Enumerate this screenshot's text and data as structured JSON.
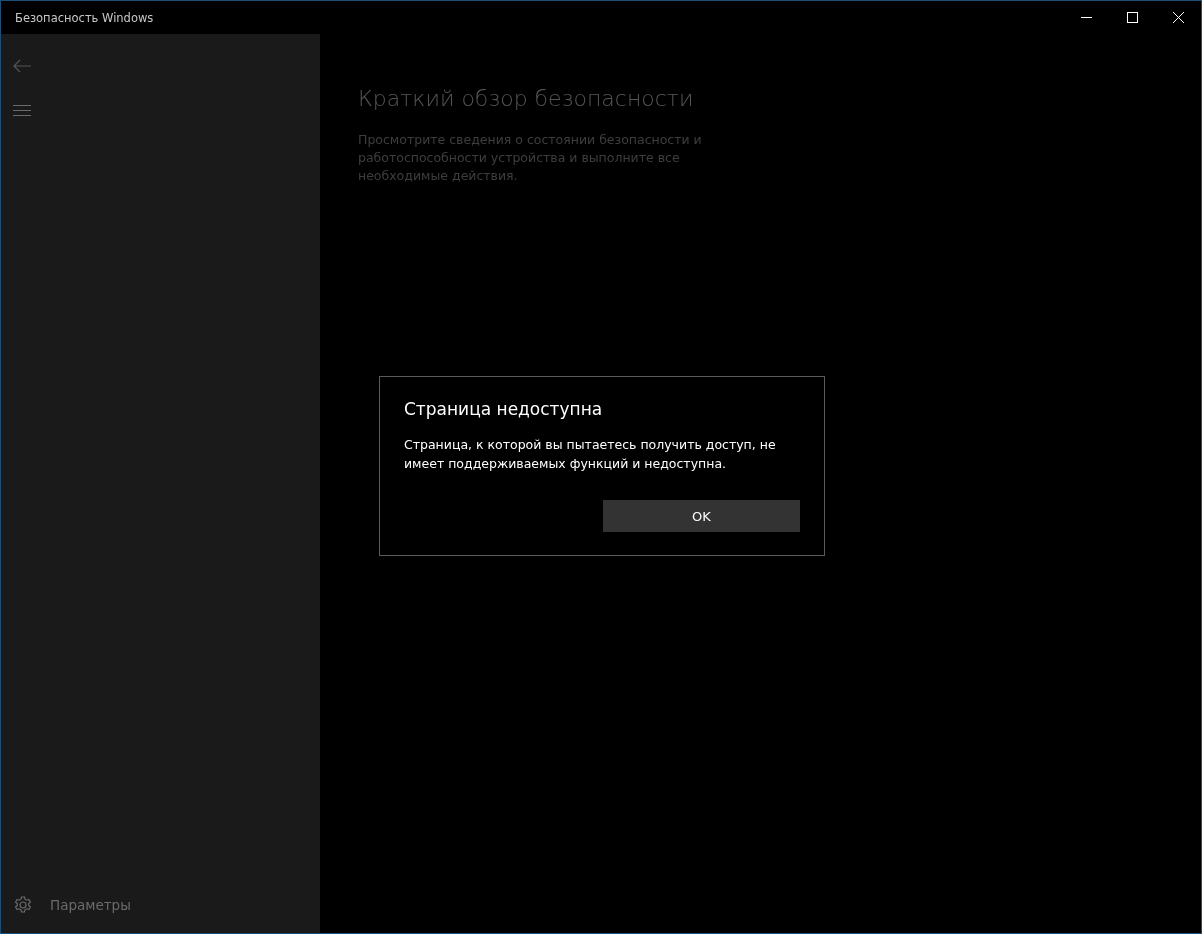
{
  "window": {
    "title": "Безопасность Windows"
  },
  "sidebar": {
    "settings_label": "Параметры"
  },
  "page": {
    "title": "Краткий обзор безопасности",
    "description": "Просмотрите сведения о состоянии безопасности и работоспособности устройства и выполните все необходимые действия."
  },
  "dialog": {
    "title": "Страница недоступна",
    "message": "Страница, к которой вы пытаетесь получить доступ, не имеет поддерживаемых функций и недоступна.",
    "buttons": [
      "OK"
    ]
  }
}
